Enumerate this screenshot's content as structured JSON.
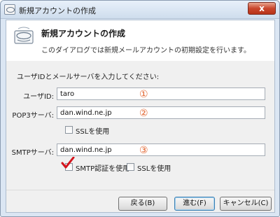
{
  "window": {
    "title": "新規アカウントの作成",
    "close_symbol": "x"
  },
  "header": {
    "title": "新規アカウントの作成",
    "description": "このダイアログでは新規メールアカウントの初期設定を行います。"
  },
  "form": {
    "instruction": "ユーザIDとメールサーバを入力してください:",
    "user_id": {
      "label": "ユーザID:",
      "value": "taro",
      "marker": "①"
    },
    "pop3": {
      "label": "POP3サーバ:",
      "value": "dan.wind.ne.jp",
      "marker": "②"
    },
    "pop3_ssl": {
      "label": "SSLを使用",
      "checked": false
    },
    "smtp": {
      "label": "SMTPサーバ:",
      "value": "dan.wind.ne.jp",
      "marker": "③"
    },
    "smtp_auth": {
      "label": "SMTP認証を使用",
      "checked": true
    },
    "smtp_ssl": {
      "label": "SSLを使用",
      "checked": false
    }
  },
  "buttons": {
    "back": "戻る(B)",
    "next": "進む(F)",
    "cancel": "キャンセル(C)"
  },
  "colors": {
    "marker": "#e2632d",
    "check_mark": "#d4141c"
  }
}
